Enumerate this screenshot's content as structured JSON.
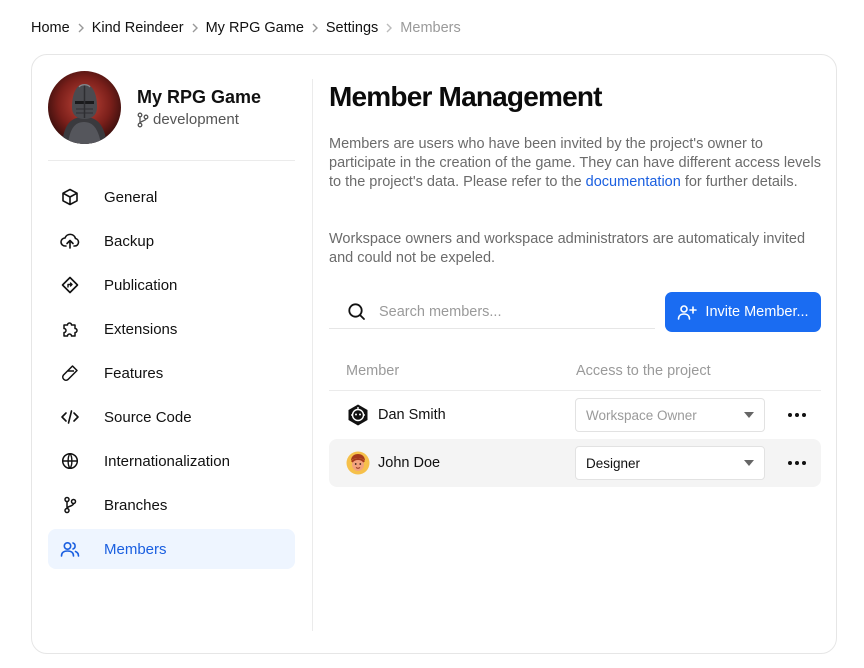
{
  "breadcrumb": {
    "items": [
      "Home",
      "Kind Reindeer",
      "My RPG Game",
      "Settings"
    ],
    "current": "Members"
  },
  "project": {
    "name": "My RPG Game",
    "branch": "development",
    "avatar_icon": "armored-knight-avatar"
  },
  "sidebar": {
    "items": [
      {
        "label": "General",
        "icon": "cube-icon"
      },
      {
        "label": "Backup",
        "icon": "cloud-upload-icon"
      },
      {
        "label": "Publication",
        "icon": "direction-sign-icon"
      },
      {
        "label": "Extensions",
        "icon": "puzzle-icon"
      },
      {
        "label": "Features",
        "icon": "flask-icon"
      },
      {
        "label": "Source Code",
        "icon": "code-icon"
      },
      {
        "label": "Internationalization",
        "icon": "globe-icon"
      },
      {
        "label": "Branches",
        "icon": "git-branch-icon"
      },
      {
        "label": "Members",
        "icon": "users-icon",
        "active": true
      }
    ]
  },
  "main": {
    "title": "Member Management",
    "description": {
      "before_link": "Members are users who have been invited by the project's owner to participate in the creation of the game. They can have different access levels to the project's data. Please refer to the ",
      "link": "documentation",
      "after_link": " for further details."
    },
    "note": "Workspace owners and workspace administrators are automaticaly invited and could not be expeled.",
    "search": {
      "placeholder": "Search members...",
      "value": ""
    },
    "invite_button": "Invite Member...",
    "table": {
      "headers": {
        "member": "Member",
        "access": "Access to the project"
      },
      "rows": [
        {
          "name": "Dan Smith",
          "avatar": "hex-robot-avatar",
          "access": "Workspace Owner",
          "disabled": true
        },
        {
          "name": "John Doe",
          "avatar": "cartoon-face-avatar",
          "access": "Designer",
          "disabled": false
        }
      ]
    }
  },
  "colors": {
    "accent": "#1a6cf2",
    "link": "#1a5fe0",
    "active_nav_bg": "#eef5ff",
    "muted_text": "#6b6b6b"
  }
}
